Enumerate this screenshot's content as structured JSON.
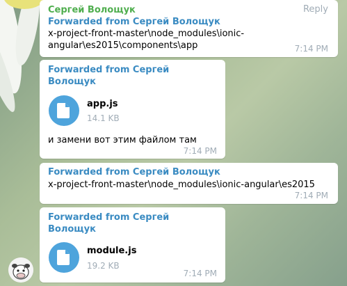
{
  "colors": {
    "sender": "#4fae4e",
    "forwarded": "#3a8bc2",
    "file_icon_bg": "#4ea4dc",
    "meta": "#a0acb6"
  },
  "messages": [
    {
      "sender": "Сергей Волощук",
      "reply_label": "Reply",
      "forwarded": "Forwarded from Сергей Волощук",
      "text_lines": [
        "x-project-front-master\\node_modules\\ionic-",
        "angular\\es2015\\components\\app"
      ],
      "time": "7:14 PM"
    },
    {
      "forwarded_lines": [
        "Forwarded from Сергей",
        "Волощук"
      ],
      "file_name": "app.js",
      "file_size": "14.1 KB",
      "file_icon": "document-icon",
      "text": "и замени вот этим файлом там",
      "time": "7:14 PM"
    },
    {
      "forwarded": "Forwarded from Сергей Волощук",
      "text": "x-project-front-master\\node_modules\\ionic-angular\\es2015",
      "time": "7:14 PM"
    },
    {
      "forwarded_lines": [
        "Forwarded from Сергей",
        "Волощук"
      ],
      "file_name": "module.js",
      "file_size": "19.2 KB",
      "file_icon": "document-icon",
      "time": "7:14 PM"
    }
  ],
  "avatar_icon": "cow-avatar-icon"
}
